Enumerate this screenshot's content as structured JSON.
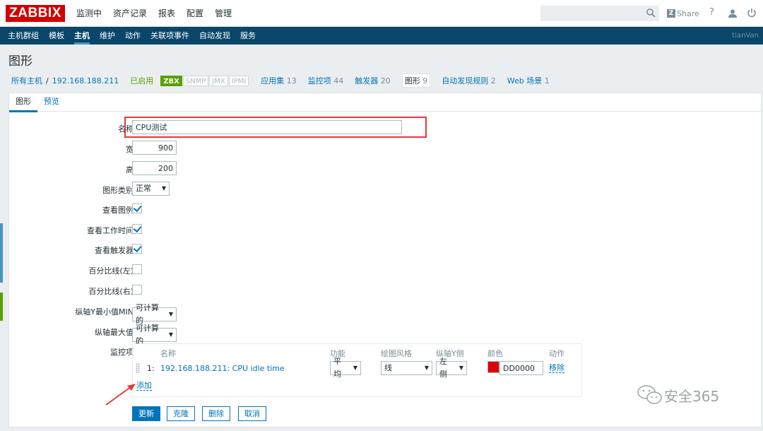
{
  "logo": "ZABBIX",
  "main_menu": [
    "监测中",
    "资产记录",
    "报表",
    "配置",
    "管理"
  ],
  "share_label": "Share",
  "help_label": "?",
  "sub_menu": [
    "主机群组",
    "模板",
    "主机",
    "维护",
    "动作",
    "关联项事件",
    "自动发现",
    "服务"
  ],
  "username": "tianVan",
  "page_title": "图形",
  "host_nav": {
    "all_hosts": "所有主机",
    "separator": "/",
    "host": "192.168.188.211",
    "status": "已启用",
    "badges": [
      "ZBX",
      "SNMP",
      "JMX",
      "IPMI"
    ],
    "applications": {
      "label": "应用集",
      "count": "13"
    },
    "items": {
      "label": "监控项",
      "count": "44"
    },
    "triggers": {
      "label": "触发器",
      "count": "20"
    },
    "graphs": {
      "label": "图形",
      "count": "9"
    },
    "discovery": {
      "label": "自动发现规则",
      "count": "2"
    },
    "web": {
      "label": "Web 场景",
      "count": "1"
    }
  },
  "tabs": [
    "图形",
    "预览"
  ],
  "form": {
    "name_label": "名称",
    "name_value": "CPU测试",
    "width_label": "宽",
    "width_value": "900",
    "height_label": "高",
    "height_value": "200",
    "graph_type_label": "图形类别",
    "graph_type_value": "正常",
    "show_legend_label": "查看图例",
    "show_working_time_label": "查看工作时间",
    "show_triggers_label": "查看触发器",
    "percentile_left_label": "百分比线(左)",
    "percentile_right_label": "百分比线(右)",
    "y_min_label": "纵轴Y最小值MIN",
    "y_min_value": "可计算的",
    "y_max_label": "纵轴最大值",
    "y_max_value": "可计算的",
    "items_label": "监控项",
    "checkboxes": {
      "show_legend": true,
      "show_working_time": true,
      "show_triggers": true,
      "percentile_left": false,
      "percentile_right": false
    }
  },
  "items_table": {
    "headers": [
      "名称",
      "功能",
      "绘图风格",
      "纵轴Y侧",
      "颜色",
      "动作"
    ],
    "rows": [
      {
        "num": "1:",
        "name": "192.168.188.211: CPU idle time",
        "function": "平均",
        "style": "线",
        "yaxis": "左侧",
        "color": "DD0000",
        "color_hex": "#dd0000",
        "action": "移除"
      }
    ],
    "add_label": "添加"
  },
  "buttons": {
    "update": "更新",
    "clone": "克隆",
    "delete": "删除",
    "cancel": "取消"
  },
  "watermark": "安全365",
  "colors": {
    "brand": "#d40000",
    "nav": "#0a466a",
    "link": "#0275b8",
    "enabled": "#59a100"
  }
}
